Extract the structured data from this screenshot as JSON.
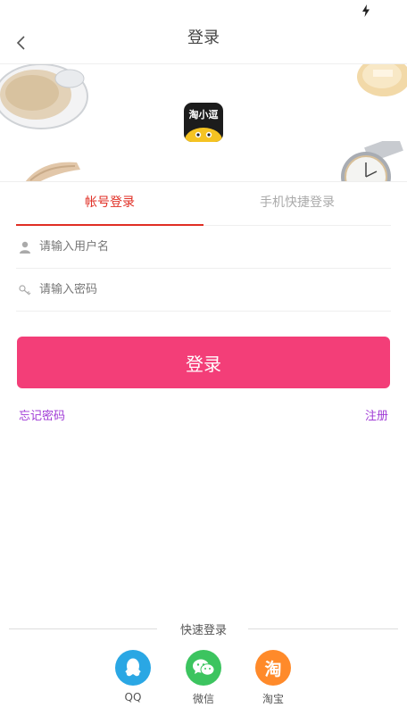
{
  "nav": {
    "title": "登录"
  },
  "banner": {
    "logo_text": "淘小逗"
  },
  "tabs": [
    {
      "label": "帐号登录",
      "active": true
    },
    {
      "label": "手机快捷登录",
      "active": false
    }
  ],
  "form": {
    "username_placeholder": "请输入用户名",
    "password_placeholder": "请输入密码",
    "submit_label": "登录"
  },
  "links": {
    "forgot": "忘记密码",
    "register": "注册"
  },
  "quick_login": {
    "title": "快速登录",
    "providers": [
      {
        "label": "QQ",
        "icon": "qq-icon",
        "color": "#2aa7e4"
      },
      {
        "label": "微信",
        "icon": "wechat-icon",
        "color": "#3cc45f"
      },
      {
        "label": "淘宝",
        "icon": "taobao-icon",
        "color": "#ff8a2a",
        "glyph": "淘"
      }
    ]
  },
  "colors": {
    "accent": "#e02e24",
    "primary_button": "#f33e78",
    "link": "#a03bd6"
  }
}
